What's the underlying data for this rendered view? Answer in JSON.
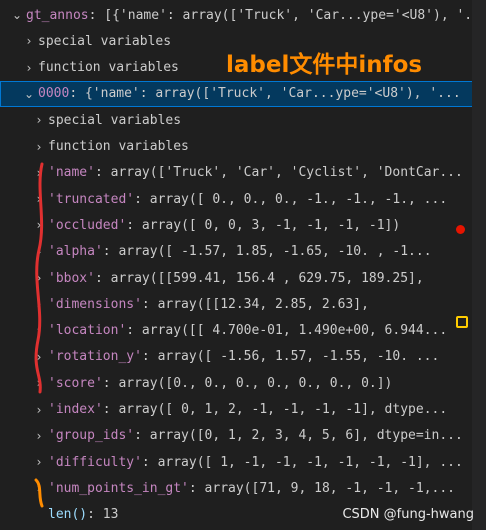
{
  "rows": [
    {
      "indent": 8,
      "chev": "⌄",
      "key": "gt_annos",
      "val": ": [{'name': array(['Truck', 'Car...ype='<U8'), '..."
    },
    {
      "indent": 20,
      "chev": "›",
      "special": "special variables"
    },
    {
      "indent": 20,
      "chev": "›",
      "special": "function variables"
    },
    {
      "indent": 20,
      "chev": "⌄",
      "key": "0000",
      "val": ": {'name': array(['Truck', 'Car...ype='<U8'), '...",
      "selected": true
    },
    {
      "indent": 30,
      "chev": "›",
      "special": "special variables"
    },
    {
      "indent": 30,
      "chev": "›",
      "special": "function variables"
    },
    {
      "indent": 30,
      "chev": "›",
      "key": "'name'",
      "val": ": array(['Truck', 'Car', 'Cyclist', 'DontCar..."
    },
    {
      "indent": 30,
      "chev": "›",
      "key": "'truncated'",
      "val": ": array([ 0.,  0.,  0., -1., -1., -1., ..."
    },
    {
      "indent": 30,
      "chev": "›",
      "key": "'occluded'",
      "val": ": array([ 0,  0,  3, -1, -1, -1, -1])"
    },
    {
      "indent": 30,
      "chev": "›",
      "key": "'alpha'",
      "val": ": array([ -1.57,   1.85,  -1.65, -10.  , -1..."
    },
    {
      "indent": 30,
      "chev": "›",
      "key": "'bbox'",
      "val": ": array([[599.41, 156.4 , 629.75, 189.25],"
    },
    {
      "indent": 30,
      "chev": "›",
      "key": "'dimensions'",
      "val": ": array([[12.34,  2.85,  2.63],"
    },
    {
      "indent": 30,
      "chev": "›",
      "key": "'location'",
      "val": ": array([[ 4.700e-01,  1.490e+00,  6.944..."
    },
    {
      "indent": 30,
      "chev": "›",
      "key": "'rotation_y'",
      "val": ": array([ -1.56,   1.57,  -1.55, -10.  ..."
    },
    {
      "indent": 30,
      "chev": "›",
      "key": "'score'",
      "val": ": array([0., 0., 0., 0., 0., 0., 0.])"
    },
    {
      "indent": 30,
      "chev": "›",
      "key": "'index'",
      "val": ": array([ 0,  1,  2, -1, -1, -1, -1], dtype..."
    },
    {
      "indent": 30,
      "chev": "›",
      "key": "'group_ids'",
      "val": ": array([0, 1, 2, 3, 4, 5, 6], dtype=in..."
    },
    {
      "indent": 30,
      "chev": "›",
      "key": "'difficulty'",
      "val": ": array([ 1, -1, -1, -1, -1, -1, -1], ..."
    },
    {
      "indent": 30,
      "chev": "›",
      "key": "'num_points_in_gt'",
      "val": ": array([71,  9, 18, -1, -1, -1,..."
    },
    {
      "indent": 30,
      "chev": "",
      "plainkey": "len()",
      "val": ": 13"
    }
  ],
  "annotation": "label文件中infos",
  "watermark": "CSDN @fung-hwang",
  "colors": {
    "annotation": "#ff8c00",
    "selection": "#04395e",
    "breakpoint": "#e51400"
  },
  "icons": [
    "chevron-right-icon",
    "chevron-down-icon",
    "breakpoint-icon",
    "debug-pointer-icon"
  ]
}
